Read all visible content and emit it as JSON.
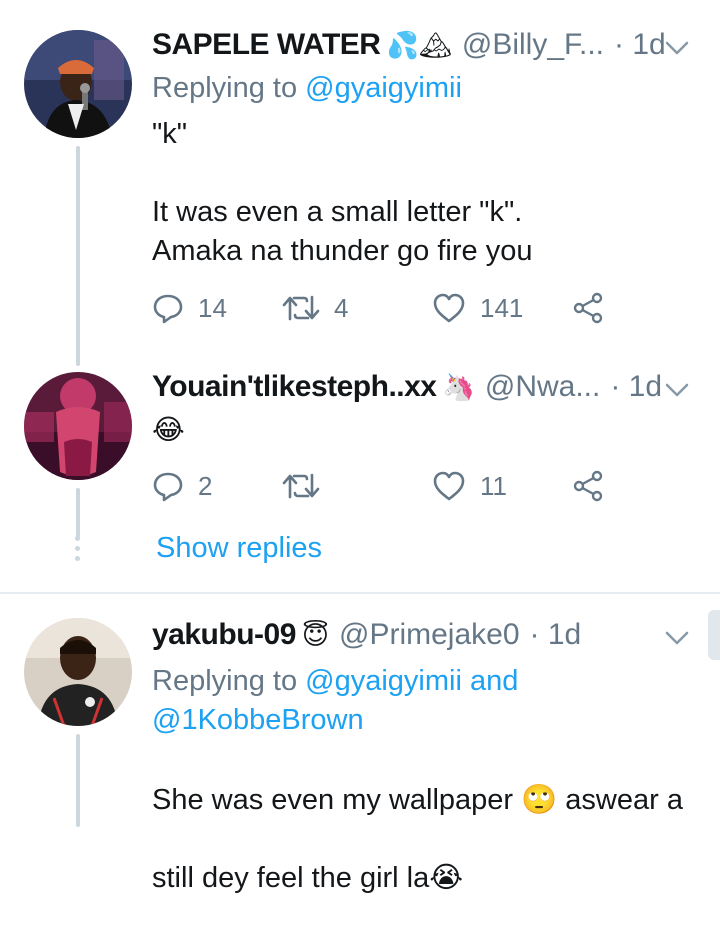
{
  "tweets": [
    {
      "name": "SAPELE WATER",
      "name_emoji": "💦🏔",
      "handle": "@Billy_F...",
      "time": "· 1d",
      "replying_prefix": "Replying to ",
      "replying_to": "@gyaigyimii",
      "body": "\"k\"\n\nIt was even a small letter \"k\".\nAmaka na thunder go fire you",
      "replies": "14",
      "retweets": "4",
      "likes": "141"
    },
    {
      "name": "Youain'tlikesteph..xx",
      "name_emoji": "🦄",
      "handle": "@Nwa...",
      "time": "· 1d",
      "body": "😂",
      "replies": "2",
      "retweets": "",
      "likes": "11",
      "show_replies": "Show replies"
    },
    {
      "name": "yakubu-09",
      "name_emoji": "😇",
      "handle": "@Primejake0",
      "time": "· 1d",
      "replying_prefix": "Replying to ",
      "replying_to": "@gyaigyimii and",
      "replying_to_2": "@1KobbeBrown",
      "body_line1": "She was even my wallpaper 🙄 aswear a",
      "body_line2": "still dey feel the girl la😭"
    }
  ],
  "colors": {
    "accent": "#1da1f2",
    "muted": "#657786",
    "thread_line": "#ccd6dd"
  },
  "icons": [
    "reply-icon",
    "retweet-icon",
    "like-icon",
    "share-icon",
    "chevron-down-icon"
  ]
}
